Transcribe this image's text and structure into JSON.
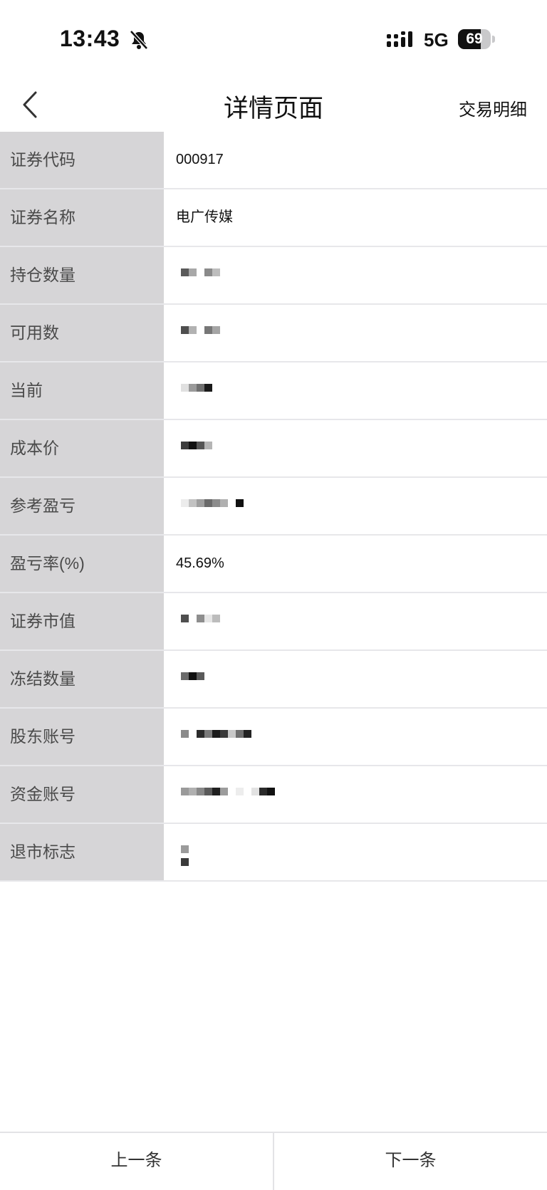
{
  "status_bar": {
    "time": "13:43",
    "network": "5G",
    "battery_level": "69",
    "battery_fraction": 0.69,
    "icons": [
      "bell-slash-icon",
      "signal-icon",
      "battery-icon"
    ]
  },
  "nav": {
    "back_icon": "chevron-left-icon",
    "title": "详情页面",
    "right_action": "交易明细"
  },
  "details": [
    {
      "label": "证券代码",
      "value": "000917"
    },
    {
      "label": "证券名称",
      "value": "电广传媒"
    },
    {
      "label": "持仓数量",
      "value": ""
    },
    {
      "label": "可用数",
      "value": ""
    },
    {
      "label": "当前",
      "value": ""
    },
    {
      "label": "成本价",
      "value": ""
    },
    {
      "label": "参考盈亏",
      "value": ""
    },
    {
      "label": "盈亏率(%)",
      "value": "45.69%"
    },
    {
      "label": "证券市值",
      "value": ""
    },
    {
      "label": "冻结数量",
      "value": ""
    },
    {
      "label": "股东账号",
      "value": ""
    },
    {
      "label": "资金账号",
      "value": ""
    },
    {
      "label": "退市标志",
      "value": ""
    }
  ],
  "bottom": {
    "prev_label": "上一条",
    "next_label": "下一条"
  }
}
